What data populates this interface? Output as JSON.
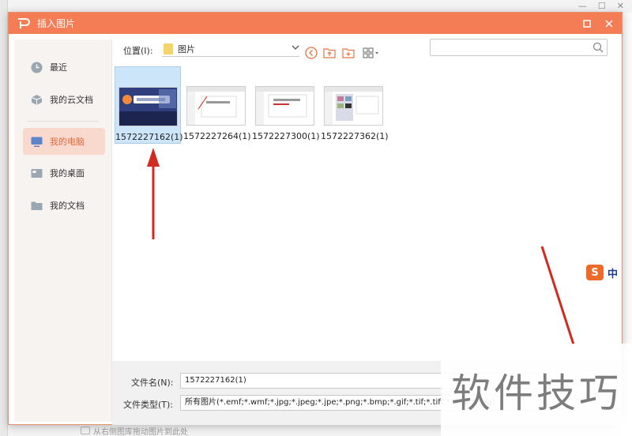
{
  "dialog": {
    "title": "插入图片"
  },
  "sidebar": {
    "items": [
      {
        "label": "最近",
        "icon": "clock-icon"
      },
      {
        "label": "我的云文档",
        "icon": "cloud-doc-icon"
      },
      {
        "label": "我的电脑",
        "icon": "computer-icon",
        "active": true
      },
      {
        "label": "我的桌面",
        "icon": "desktop-icon"
      },
      {
        "label": "我的文档",
        "icon": "folder-icon"
      }
    ]
  },
  "toolbar": {
    "location_label": "位置(I):",
    "location_value": "图片",
    "search_placeholder": ""
  },
  "files": [
    {
      "name": "1572227162(1)",
      "selected": true
    },
    {
      "name": "1572227264(1)",
      "selected": false
    },
    {
      "name": "1572227300(1)",
      "selected": false
    },
    {
      "name": "1572227362(1)",
      "selected": false
    }
  ],
  "form": {
    "filename_label": "文件名(N):",
    "filename_value": "1572227162(1)",
    "filetype_label": "文件类型(T):",
    "filetype_value": "所有图片(*.emf;*.wmf;*.jpg;*.jpeg;*.jpe;*.png;*.bmp;*.gif;*.tif;*.tiff;*.wdp;*.svg)"
  },
  "ime": {
    "logo": "S",
    "mode": "中"
  },
  "watermark": {
    "text": "软件技巧"
  },
  "background": {
    "hint": "从右侧图库拖动图片到此处"
  },
  "colors": {
    "titlebar": "#f47d56",
    "sidebar_active_bg": "#f9d9cd",
    "sidebar_active_text": "#e26a3e",
    "selection": "#cde5f8",
    "arrow": "#d12a20"
  }
}
